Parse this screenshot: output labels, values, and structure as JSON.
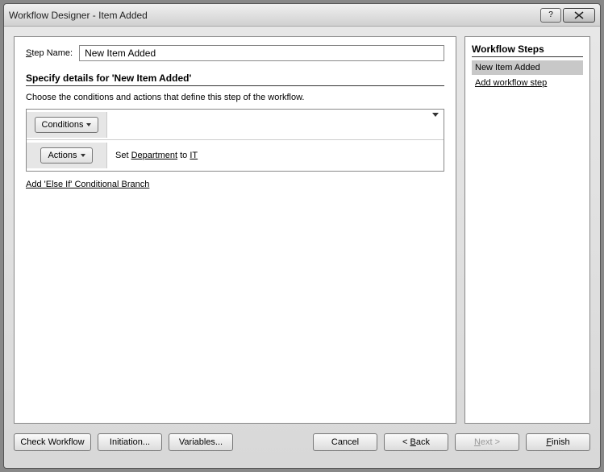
{
  "window": {
    "title": "Workflow Designer - Item Added"
  },
  "main": {
    "step_name_label_pre": "S",
    "step_name_label_post": "tep Name:",
    "step_name_value": "New Item Added",
    "section_title": "Specify details for 'New Item Added'",
    "instruction": "Choose the conditions and actions that define this step of the workflow.",
    "conditions_label": "Conditions",
    "actions_label": "Actions",
    "action_text_pre": "Set ",
    "action_field": "Department",
    "action_text_mid": " to ",
    "action_value": "IT",
    "add_else_label": "Add 'Else If' Conditional Branch"
  },
  "sidebar": {
    "title": "Workflow Steps",
    "items": [
      {
        "label": "New Item Added",
        "selected": true
      }
    ],
    "add_link": "Add workflow step"
  },
  "footer": {
    "check": "Check Workflow",
    "initiation": "Initiation...",
    "variables": "Variables...",
    "cancel": "Cancel",
    "back_pre": "< ",
    "back_u": "B",
    "back_post": "ack",
    "next_u": "N",
    "next_post": "ext >",
    "finish_u": "F",
    "finish_post": "inish"
  }
}
